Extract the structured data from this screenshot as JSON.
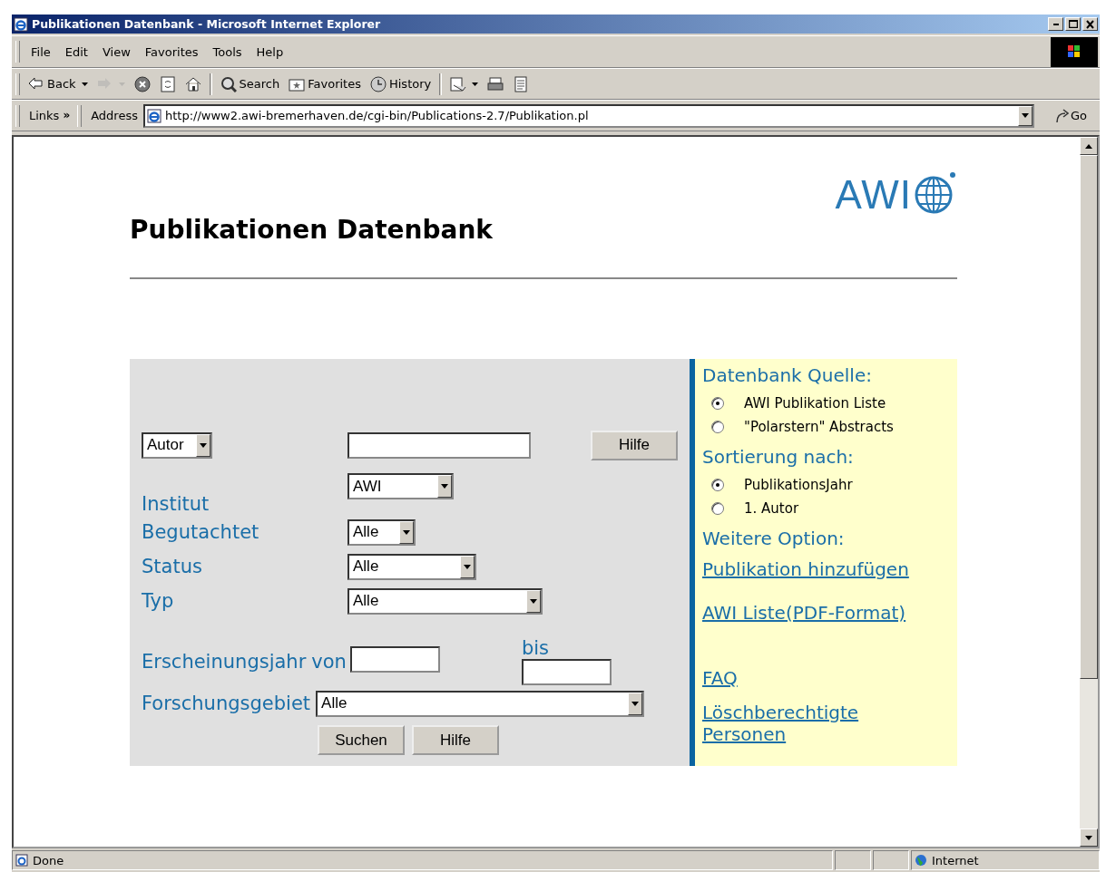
{
  "window": {
    "title": "Publikationen Datenbank - Microsoft Internet Explorer"
  },
  "menu": [
    "File",
    "Edit",
    "View",
    "Favorites",
    "Tools",
    "Help"
  ],
  "toolbar": [
    {
      "kind": "back",
      "label": "Back",
      "menu": true,
      "disabled": false
    },
    {
      "kind": "forward",
      "menu": true,
      "disabled": true
    },
    {
      "kind": "stop",
      "menu": false,
      "disabled": false
    },
    {
      "kind": "refresh",
      "menu": false,
      "disabled": false
    },
    {
      "kind": "home",
      "menu": false,
      "disabled": false
    },
    {
      "kind": "search",
      "label": "Search",
      "menu": false,
      "disabled": false
    },
    {
      "kind": "favorites",
      "label": "Favorites",
      "menu": false,
      "disabled": false
    },
    {
      "kind": "history",
      "label": "History",
      "menu": false,
      "disabled": false
    },
    {
      "kind": "mail",
      "menu": true,
      "disabled": false
    },
    {
      "kind": "print",
      "menu": false,
      "disabled": false
    },
    {
      "kind": "edit",
      "menu": false,
      "disabled": false
    }
  ],
  "address_bar": {
    "links": "Links",
    "chevron": "»",
    "label": "Address",
    "url": "http://www2.awi-bremerhaven.de/cgi-bin/Publications-2.7/Publikation.pl",
    "go": "Go"
  },
  "page": {
    "logo": "AWI",
    "heading": "Publikationen Datenbank",
    "search": {
      "field": "Autor",
      "button": "Hilfe"
    },
    "filters": [
      {
        "label": "Institut",
        "value": "AWI"
      },
      {
        "label": "Begutachtet",
        "value": "Alle"
      },
      {
        "label": "Status",
        "value": "Alle"
      },
      {
        "label": "Typ",
        "value": "Alle"
      }
    ],
    "year": {
      "label": "Erscheinungsjahr",
      "from": "von",
      "to": "bis"
    },
    "area": {
      "label": "Forschungsgebiet",
      "value": "Alle"
    },
    "buttons": [
      "Suchen",
      "Hilfe"
    ],
    "sidebar": {
      "sections": [
        {
          "title": "Datenbank Quelle:",
          "options": [
            {
              "label": "AWI Publikation Liste",
              "selected": true
            },
            {
              "label": "\"Polarstern\" Abstracts",
              "selected": false
            }
          ]
        },
        {
          "title": "Sortierung nach:",
          "options": [
            {
              "label": "PublikationsJahr",
              "selected": true
            },
            {
              "label": "1. Autor",
              "selected": false
            }
          ]
        },
        {
          "title": "Weitere Option:",
          "links": [
            "Publikation hinzufügen",
            "AWI Liste(PDF-Format)",
            "FAQ",
            "Löschberechtigte Personen"
          ]
        }
      ]
    }
  },
  "status_bar": {
    "text": "Done",
    "zone": "Internet"
  }
}
